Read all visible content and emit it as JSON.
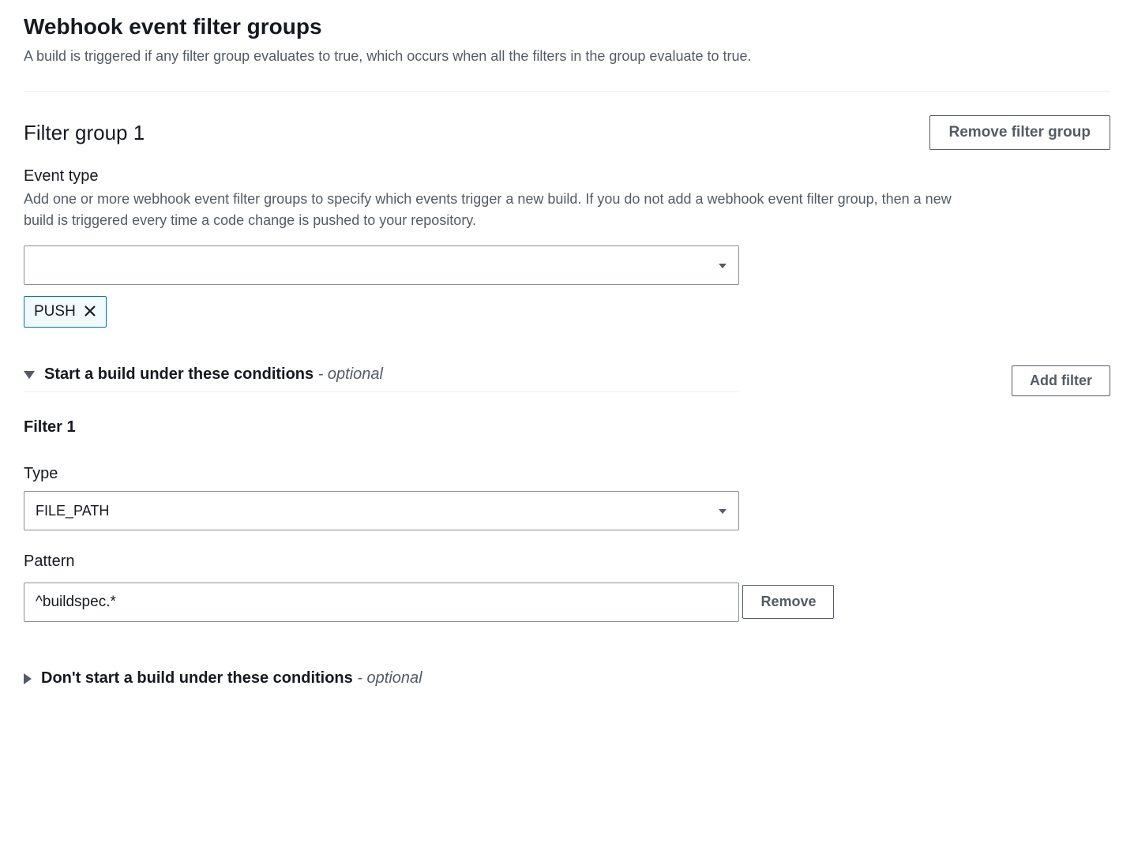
{
  "header": {
    "title": "Webhook event filter groups",
    "description": "A build is triggered if any filter group evaluates to true, which occurs when all the filters in the group evaluate to true."
  },
  "group": {
    "title": "Filter group 1",
    "remove_label": "Remove filter group",
    "event_type": {
      "label": "Event type",
      "help": "Add one or more webhook event filter groups to specify which events trigger a new build. If you do not add a webhook event filter group, then a new build is triggered every time a code change is pushed to your repository.",
      "select_value": "",
      "tag": "PUSH"
    },
    "start_conditions": {
      "title": "Start a build under these conditions",
      "optional_suffix": "- optional",
      "add_filter_label": "Add filter",
      "filter": {
        "heading": "Filter 1",
        "type_label": "Type",
        "type_value": "FILE_PATH",
        "pattern_label": "Pattern",
        "pattern_value": "^buildspec.*",
        "remove_label": "Remove"
      }
    },
    "dont_start_conditions": {
      "title": "Don't start a build under these conditions",
      "optional_suffix": "- optional"
    }
  }
}
